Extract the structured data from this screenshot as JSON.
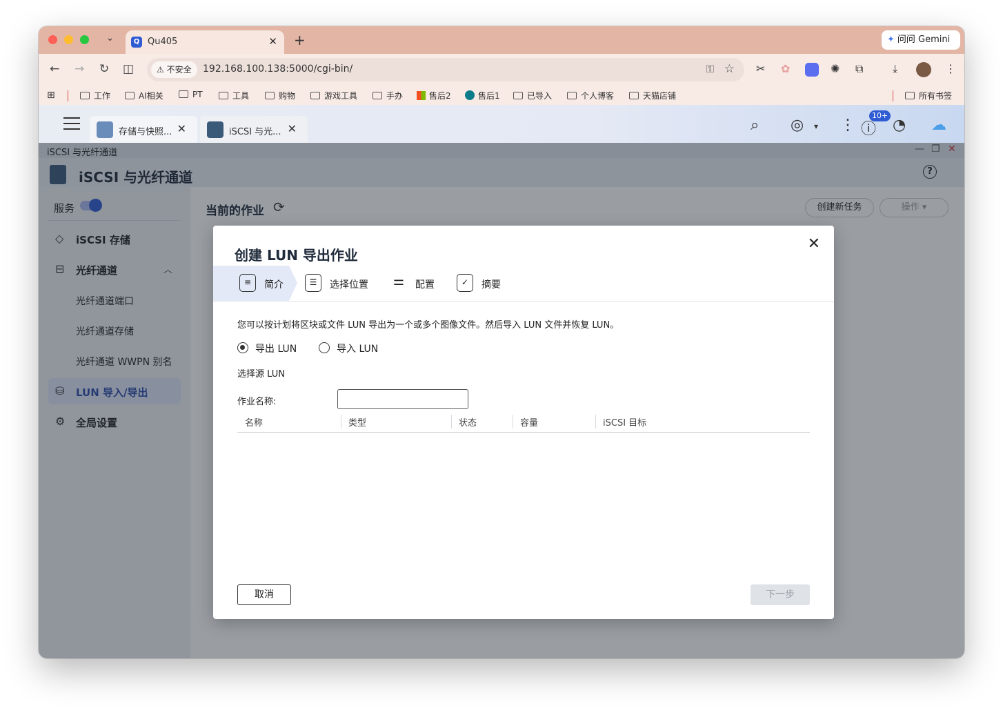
{
  "browser": {
    "tab_title": "Qu405",
    "tab_favicon": "Q",
    "gemini_label": "问问 Gemini",
    "security_label": "不安全",
    "url": "192.168.100.138:5000/cgi-bin/"
  },
  "bookmarks": {
    "items": [
      "工作",
      "AI相关",
      "PT",
      "工具",
      "购物",
      "游戏工具",
      "手办",
      "售后2",
      "售后1",
      "已导入",
      "个人博客",
      "天猫店铺"
    ],
    "all_bookmarks": "所有书签"
  },
  "qnap": {
    "tabs": [
      {
        "label": "存储与快照..."
      },
      {
        "label": "iSCSI 与光..."
      }
    ],
    "notification_badge": "10+"
  },
  "app": {
    "window_title": "iSCSI 与光纤通道",
    "header_title": "iSCSI 与光纤通道",
    "help": "?"
  },
  "sidebar": {
    "service_label": "服务",
    "items": [
      {
        "label": "iSCSI 存储"
      },
      {
        "label": "光纤通道"
      },
      {
        "label": "光纤通道端口"
      },
      {
        "label": "光纤通道存储"
      },
      {
        "label": "光纤通道 WWPN 别名"
      },
      {
        "label": "LUN 导入/导出"
      },
      {
        "label": "全局设置"
      }
    ]
  },
  "main": {
    "heading": "当前的作业",
    "create_task": "创建新任务",
    "actions": "操作 ▾"
  },
  "modal": {
    "title": "创建 LUN 导出作业",
    "steps": [
      {
        "label": "简介"
      },
      {
        "label": "选择位置"
      },
      {
        "label": "配置"
      },
      {
        "label": "摘要"
      }
    ],
    "description": "您可以按计划将区块或文件 LUN 导出为一个或多个图像文件。然后导入 LUN 文件并恢复 LUN。",
    "radio_export": "导出 LUN",
    "radio_import": "导入 LUN",
    "select_source": "选择源 LUN",
    "job_name_label": "作业名称:",
    "job_name_value": "",
    "columns": [
      "名称",
      "类型",
      "状态",
      "容量",
      "iSCSI 目标"
    ],
    "cancel": "取消",
    "next": "下一步"
  },
  "colors": {
    "accent": "#2f5bd3",
    "tabstrip": "#e2b5a4",
    "toolbar": "#f8ebe6"
  }
}
